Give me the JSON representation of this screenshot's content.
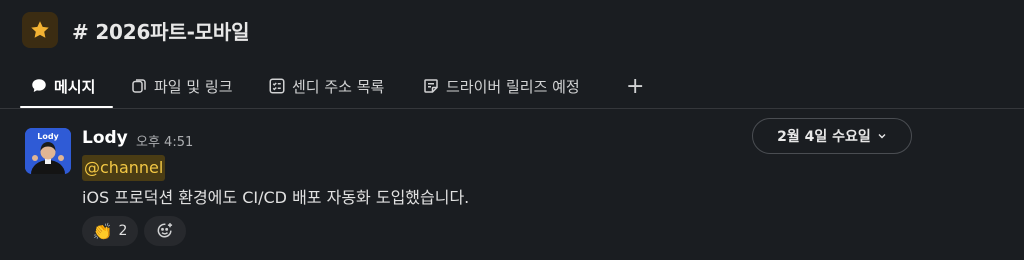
{
  "header": {
    "channel_icon": "star-icon",
    "channel_name": "# 2026파트-모바일"
  },
  "tabs": [
    {
      "label": "메시지",
      "icon": "message-bubble-icon",
      "active": true
    },
    {
      "label": "파일 및 링크",
      "icon": "files-icon",
      "active": false
    },
    {
      "label": "센디 주소 목록",
      "icon": "checklist-icon",
      "active": false
    },
    {
      "label": "드라이버 릴리즈 예정",
      "icon": "canvas-icon",
      "active": false
    }
  ],
  "add_tab_label": "+",
  "date_divider": {
    "label": "2월 4일 수요일"
  },
  "message": {
    "author": "Lody",
    "avatar_text": "Lody",
    "time": "오후 4:51",
    "mention": "@channel",
    "text": "iOS 프로덕션 환경에도 CI/CD 배포 자동화 도입했습니다.",
    "reactions": [
      {
        "emoji": "👏",
        "count": "2"
      }
    ]
  },
  "colors": {
    "background": "#1a1d21",
    "mention_bg": "#4a3c14",
    "mention_text": "#f2c744",
    "star": "#f2b233"
  }
}
